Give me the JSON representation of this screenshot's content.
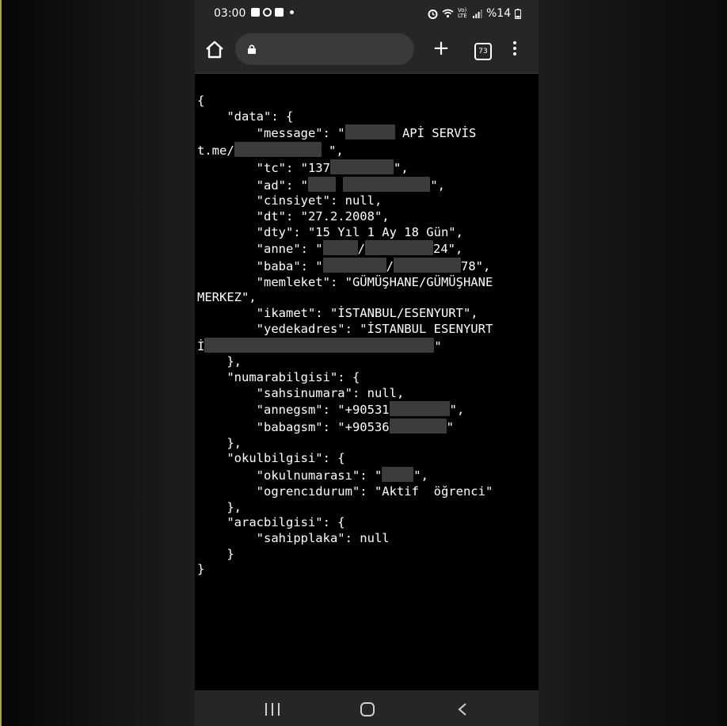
{
  "status_bar": {
    "time": "03:00",
    "network_label": "Vo) LTE",
    "battery": "%14"
  },
  "browser": {
    "url": "",
    "tabs_count": "73"
  },
  "json_text": {
    "l1": "{",
    "l2": "    \"data\": {",
    "l3a": "        \"message\": \"",
    "l3b": " APİ SERVİS",
    "l4a": "t.me/",
    "l4b": " \",",
    "l5a": "        \"tc\": \"137",
    "l5b": "\",",
    "l6a": "        \"ad\": \"",
    "l6b": "\",",
    "l7": "        \"cinsiyet\": null,",
    "l8": "        \"dt\": \"27.2.2008\",",
    "l9": "        \"dty\": \"15 Yıl 1 Ay 18 Gün\",",
    "l10a": "        \"anne\": \"",
    "l10b": "/",
    "l10c": "24\",",
    "l11a": "        \"baba\": \"",
    "l11b": "/",
    "l11c": "78\",",
    "l12": "        \"memleket\": \"GÜMÜŞHANE/GÜMÜŞHANE",
    "l13": "MERKEZ\",",
    "l14": "        \"ikamet\": \"İSTANBUL/ESENYURT\",",
    "l15": "        \"yedekadres\": \"İSTANBUL ESENYURT",
    "l16a": "İ",
    "l16b": "\"",
    "l17": "    },",
    "l18": "    \"numarabilgisi\": {",
    "l19": "        \"sahsinumara\": null,",
    "l20a": "        \"annegsm\": \"+90531",
    "l20b": "\",",
    "l21a": "        \"babagsm\": \"+90536",
    "l21b": "\"",
    "l22": "    },",
    "l23": "    \"okulbilgisi\": {",
    "l24a": "        \"okulnumarası\": \"",
    "l24b": "\",",
    "l25": "        \"ogrencıdurum\": \"Aktif  öğrenci\"",
    "l26": "    },",
    "l27": "    \"aracbilgisi\": {",
    "l28": "        \"sahipplaka\": null",
    "l29": "    }",
    "l30": "}"
  },
  "nav_bar": {
    "icons": [
      "recents-icon",
      "home-icon",
      "back-icon"
    ]
  }
}
